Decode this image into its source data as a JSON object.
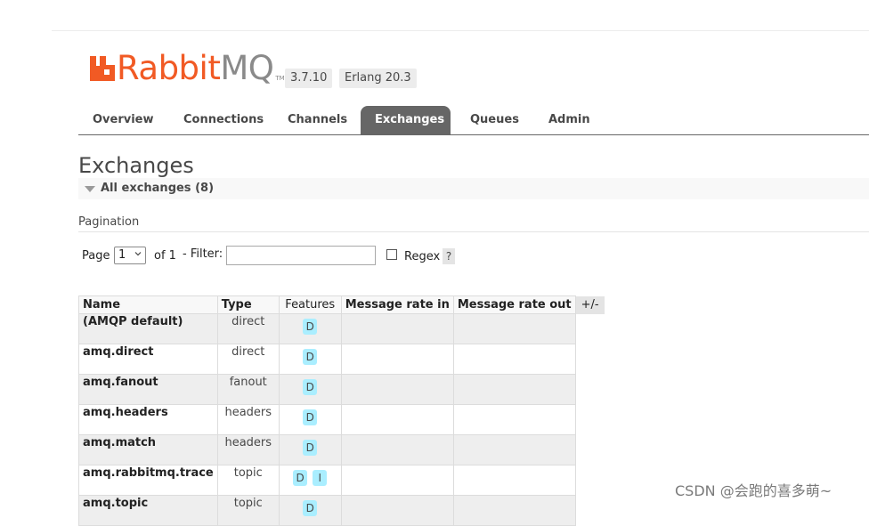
{
  "brand": {
    "name_part1": "Rabbit",
    "name_part2": "MQ",
    "trademark": "TM",
    "accent_color": "#f15a24",
    "secondary_color": "#8a8a8a"
  },
  "versions": {
    "app": "3.7.10",
    "erlang": "Erlang 20.3"
  },
  "tabs": [
    {
      "label": "Overview",
      "active": false
    },
    {
      "label": "Connections",
      "active": false
    },
    {
      "label": "Channels",
      "active": false
    },
    {
      "label": "Exchanges",
      "active": true
    },
    {
      "label": "Queues",
      "active": false
    },
    {
      "label": "Admin",
      "active": false
    }
  ],
  "page": {
    "title": "Exchanges",
    "section_label": "All exchanges (8)"
  },
  "pagination": {
    "title": "Pagination",
    "page_label": "Page",
    "page_value": "1",
    "of_label": "of 1",
    "filter_label": "- Filter:",
    "filter_value": "",
    "regex_label": "Regex",
    "regex_checked": false,
    "help_label": "?"
  },
  "table": {
    "columns": [
      "Name",
      "Type",
      "Features",
      "Message rate in",
      "Message rate out"
    ],
    "toggle_label": "+/-",
    "rows": [
      {
        "name": "(AMQP default)",
        "type": "direct",
        "features": [
          "D"
        ],
        "rate_in": "",
        "rate_out": ""
      },
      {
        "name": "amq.direct",
        "type": "direct",
        "features": [
          "D"
        ],
        "rate_in": "",
        "rate_out": ""
      },
      {
        "name": "amq.fanout",
        "type": "fanout",
        "features": [
          "D"
        ],
        "rate_in": "",
        "rate_out": ""
      },
      {
        "name": "amq.headers",
        "type": "headers",
        "features": [
          "D"
        ],
        "rate_in": "",
        "rate_out": ""
      },
      {
        "name": "amq.match",
        "type": "headers",
        "features": [
          "D"
        ],
        "rate_in": "",
        "rate_out": ""
      },
      {
        "name": "amq.rabbitmq.trace",
        "type": "topic",
        "features": [
          "D",
          "I"
        ],
        "rate_in": "",
        "rate_out": ""
      },
      {
        "name": "amq.topic",
        "type": "topic",
        "features": [
          "D"
        ],
        "rate_in": "",
        "rate_out": ""
      }
    ]
  },
  "watermark": "CSDN @会跑的喜多萌~"
}
